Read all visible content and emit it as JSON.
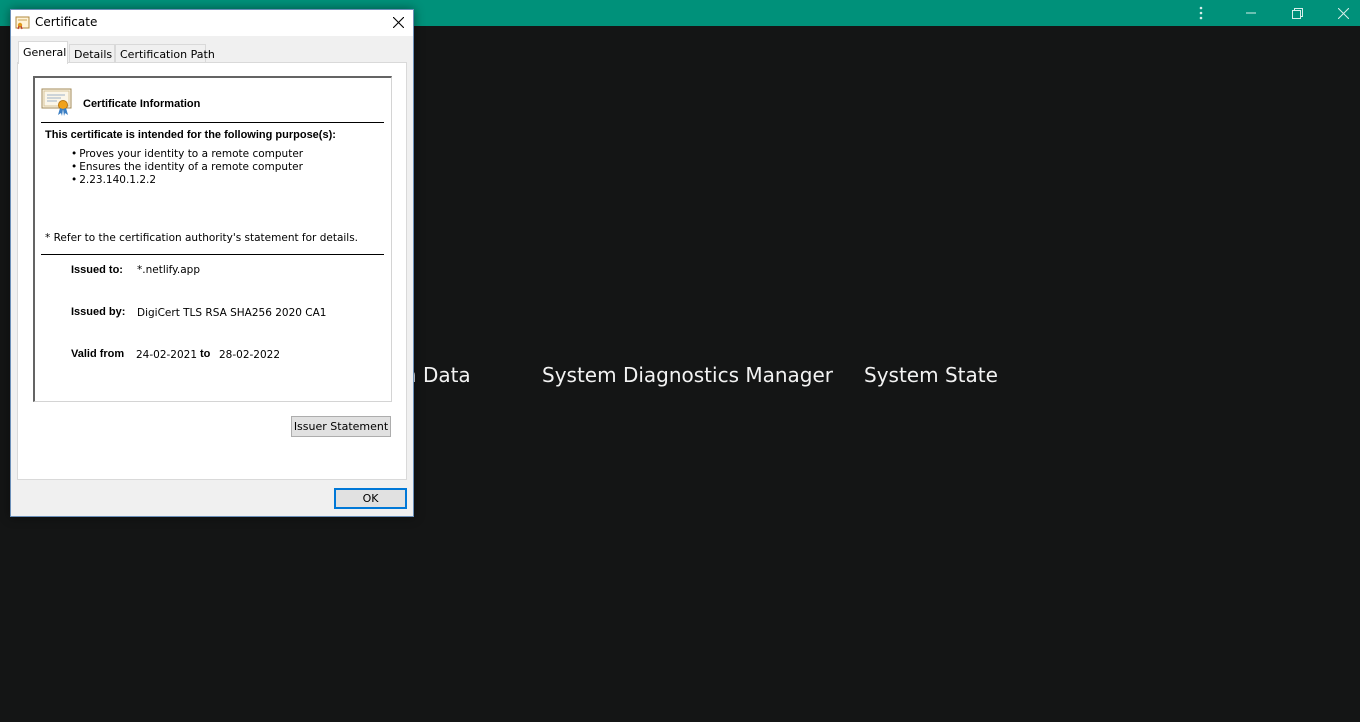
{
  "app": {
    "menu_items": [
      "System Data",
      "System Diagnostics Manager",
      "System State"
    ],
    "window_controls": [
      "more-icon",
      "minimize-icon",
      "maximize-icon",
      "close-icon"
    ],
    "colors": {
      "titlebar": "#00917a",
      "background": "#141515"
    }
  },
  "dialog": {
    "title": "Certificate",
    "tabs": [
      "General",
      "Details",
      "Certification Path"
    ],
    "active_tab": "General",
    "info": {
      "title": "Certificate Information",
      "purpose_heading": "This certificate is intended for the following purpose(s):",
      "purposes": [
        "Proves your identity to a remote computer",
        "Ensures the identity of a remote computer",
        "2.23.140.1.2.2"
      ],
      "refer_note": "* Refer to the certification authority's statement for details.",
      "issued_to_label": "Issued to:",
      "issued_to": "*.netlify.app",
      "issued_by_label": "Issued by:",
      "issued_by": "DigiCert TLS RSA SHA256 2020 CA1",
      "valid_from_label": "Valid from",
      "valid_from": "24-02-2021",
      "valid_to_label": "to",
      "valid_to": "28-02-2022"
    },
    "issuer_statement_button": "Issuer Statement",
    "ok_button": "OK"
  }
}
